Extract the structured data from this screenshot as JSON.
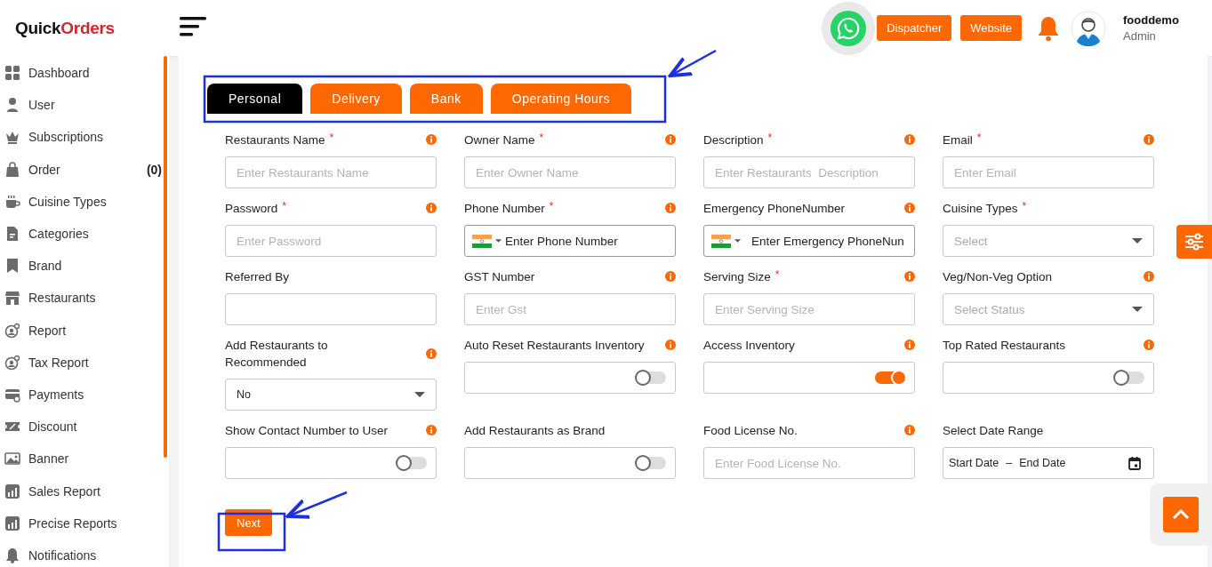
{
  "logo": {
    "first": "Quick",
    "second": "Orders"
  },
  "sidebar": {
    "items": [
      {
        "label": "Dashboard"
      },
      {
        "label": "User"
      },
      {
        "label": "Subscriptions"
      },
      {
        "label": "Order",
        "count": "(0)"
      },
      {
        "label": "Cuisine Types"
      },
      {
        "label": "Categories"
      },
      {
        "label": "Brand"
      },
      {
        "label": "Restaurants"
      },
      {
        "label": "Report"
      },
      {
        "label": "Tax Report"
      },
      {
        "label": "Payments"
      },
      {
        "label": "Discount"
      },
      {
        "label": "Banner"
      },
      {
        "label": "Sales Report"
      },
      {
        "label": "Precise Reports"
      },
      {
        "label": "Notifications"
      }
    ]
  },
  "header": {
    "buttons": [
      "Dispatcher",
      "Website"
    ],
    "user": {
      "name": "fooddemo",
      "role": "Admin"
    }
  },
  "tabs": [
    {
      "label": "Personal",
      "selected": true
    },
    {
      "label": "Delivery",
      "selected": false
    },
    {
      "label": "Bank",
      "selected": false
    },
    {
      "label": "Operating Hours",
      "selected": false
    }
  ],
  "fields": [
    {
      "kind": "text",
      "label": "Restaurants Name",
      "mark": "*",
      "info": true,
      "placeholder": "Enter Restaurants Name"
    },
    {
      "kind": "text",
      "label": "Owner Name",
      "mark": "*",
      "info": true,
      "placeholder": "Enter Owner Name"
    },
    {
      "kind": "text",
      "label": "Description",
      "mark": "*",
      "info": true,
      "placeholder": "Enter Restaurants  Description"
    },
    {
      "kind": "text",
      "label": "Email",
      "mark": "*",
      "info": true,
      "placeholder": "Enter Email"
    },
    {
      "kind": "text",
      "label": "Password",
      "mark": "*",
      "info": true,
      "placeholder": "Enter Password"
    },
    {
      "kind": "phone",
      "label": "Phone Number",
      "mark": "*",
      "info": true,
      "placeholder": "Enter Phone Number"
    },
    {
      "kind": "phone",
      "label": "Emergency PhoneNumber",
      "info": true,
      "placeholder": "Enter Emergency PhoneNun"
    },
    {
      "kind": "select",
      "label": "Cuisine Types",
      "mark": "*",
      "info": false,
      "placeholder": "Select"
    },
    {
      "kind": "text",
      "label": "Referred By",
      "info": false
    },
    {
      "kind": "text",
      "label": "GST Number",
      "info": true,
      "placeholder": "Enter Gst"
    },
    {
      "kind": "text",
      "label": "Serving Size",
      "mark": "*",
      "info": true,
      "placeholder": "Enter Serving Size"
    },
    {
      "kind": "select",
      "label": "Veg/Non-Veg Option",
      "info": true,
      "placeholder": "Select Status"
    },
    {
      "kind": "select",
      "label": "Add Restaurants to Recommended",
      "info": true,
      "value": "No"
    },
    {
      "kind": "toggle",
      "label": "Auto Reset Restaurants Inventory",
      "info": true,
      "on": false
    },
    {
      "kind": "toggle",
      "label": "Access Inventory",
      "info": true,
      "on": true
    },
    {
      "kind": "toggle",
      "label": "Top Rated Restaurants",
      "info": true,
      "on": false
    },
    {
      "kind": "toggle",
      "label": "Show Contact Number to User",
      "info": true,
      "on": false
    },
    {
      "kind": "toggle",
      "label": "Add Restaurants as Brand",
      "info": false,
      "on": false
    },
    {
      "kind": "text",
      "label": "Food License No.",
      "info": true,
      "placeholder": "Enter Food License No."
    },
    {
      "kind": "date",
      "label": "Select Date Range",
      "info": false,
      "start": "Start Date",
      "separator": "–",
      "end": "End Date"
    }
  ],
  "next_button": "Next"
}
